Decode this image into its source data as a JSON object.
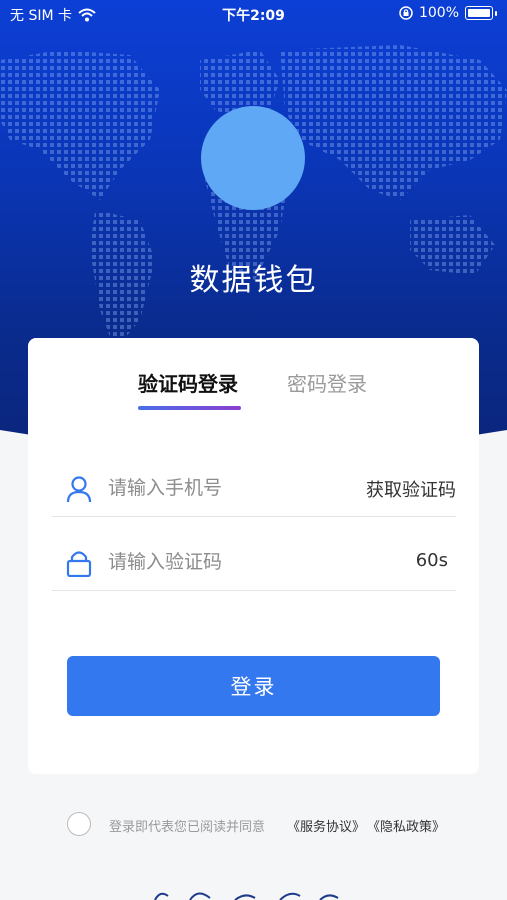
{
  "status_bar": {
    "carrier": "无 SIM 卡",
    "time": "下午2:09",
    "battery": "100%"
  },
  "app": {
    "title": "数据钱包"
  },
  "tabs": [
    {
      "label": "验证码登录",
      "active": true
    },
    {
      "label": "密码登录",
      "active": false
    }
  ],
  "form": {
    "phone_placeholder": "请输入手机号",
    "get_code_label": "获取验证码",
    "code_placeholder": "请输入验证码",
    "countdown": "60s",
    "login_label": "登录"
  },
  "agreement": {
    "text": "登录即代表您已阅读并同意",
    "service_link": "《服务协议》",
    "privacy_link": "《隐私政策》"
  },
  "colors": {
    "hero_top": "#0c3fd6",
    "hero_bottom": "#0a2478",
    "logo": "#5fa8f5",
    "primary_button": "#3478f0",
    "tab_gradient_start": "#4a6de8",
    "tab_gradient_end": "#8a3fd0"
  },
  "icons": [
    "wifi-icon",
    "lock-rotation-icon",
    "battery-icon",
    "user-icon",
    "lock-icon"
  ]
}
